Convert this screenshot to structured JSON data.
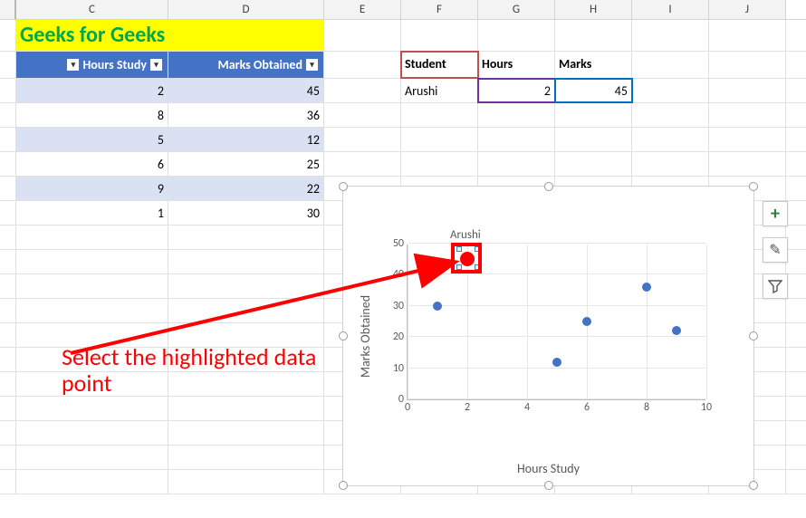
{
  "columns": [
    "C",
    "D",
    "E",
    "F",
    "G",
    "H",
    "I",
    "J"
  ],
  "title": "Geeks for Geeks",
  "table": {
    "headers": {
      "hours": "Hours Study",
      "marks": "Marks Obtained"
    },
    "rows": [
      {
        "hours": "2",
        "marks": "45"
      },
      {
        "hours": "8",
        "marks": "36"
      },
      {
        "hours": "5",
        "marks": "12"
      },
      {
        "hours": "6",
        "marks": "25"
      },
      {
        "hours": "9",
        "marks": "22"
      },
      {
        "hours": "1",
        "marks": "30"
      }
    ]
  },
  "lookup": {
    "headers": {
      "student": "Student",
      "hours": "Hours",
      "marks": "Marks"
    },
    "row": {
      "student": "Arushi",
      "hours": "2",
      "marks": "45"
    }
  },
  "annotation": "Select the highlighted data point",
  "chart_data": {
    "type": "scatter",
    "x": [
      2,
      8,
      5,
      6,
      9,
      1
    ],
    "y": [
      45,
      36,
      12,
      25,
      22,
      30
    ],
    "highlighted": {
      "x": 2,
      "y": 45,
      "label": "Arushi"
    },
    "xlabel": "Hours Study",
    "ylabel": "Marks Obtained",
    "xlim": [
      0,
      10
    ],
    "ylim": [
      0,
      50
    ],
    "xticks": [
      0,
      2,
      4,
      6,
      8,
      10
    ],
    "yticks": [
      0,
      10,
      20,
      30,
      40,
      50
    ]
  },
  "chart_tools": {
    "plus": "+",
    "brush": "✎",
    "filter": "⏷"
  }
}
